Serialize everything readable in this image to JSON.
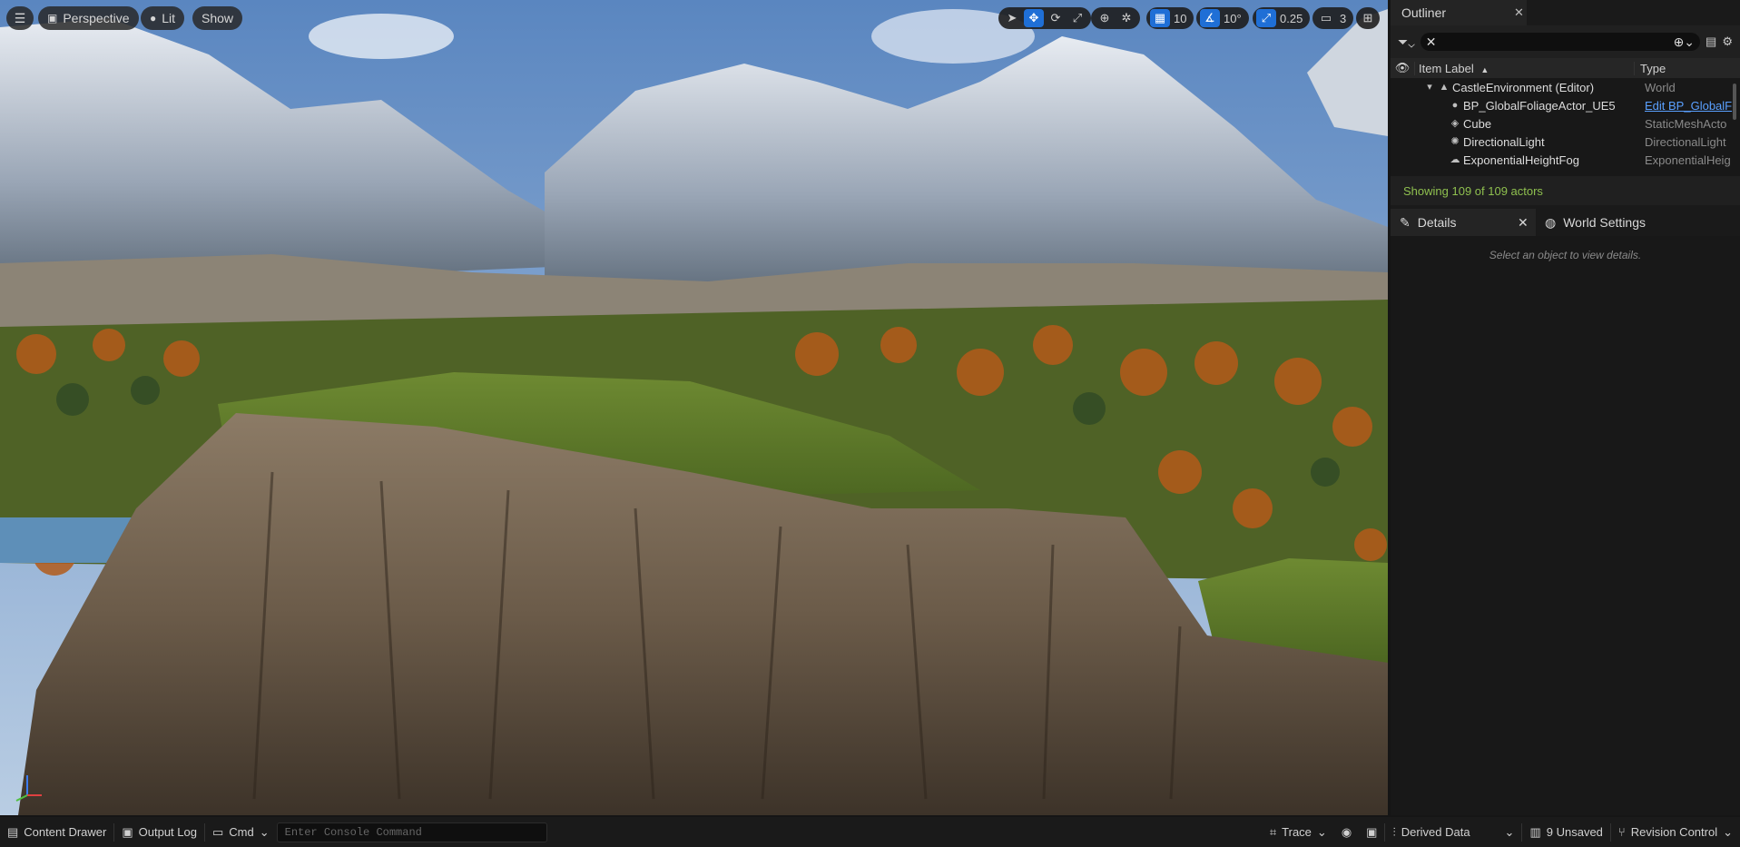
{
  "viewport": {
    "menu_icon": "hamburger-icon",
    "perspective_label": "Perspective",
    "lit_label": "Lit",
    "show_label": "Show",
    "toolbar": {
      "grid_value": "10",
      "rotation_value": "10°",
      "scale_value": "0.25",
      "camera_speed": "3",
      "accent": "#1f6fd6"
    }
  },
  "outliner": {
    "tab_title": "Outliner",
    "search_value": "",
    "col_label": "Item Label",
    "col_type": "Type",
    "rows": [
      {
        "label": "CastleEnvironment (Editor)",
        "type": "World",
        "icon": "world-icon"
      },
      {
        "label": "BP_GlobalFoliageActor_UE5",
        "type": "Edit BP_GlobalF",
        "icon": "blueprint-icon"
      },
      {
        "label": "Cube",
        "type": "StaticMeshActo",
        "icon": "cube-icon"
      },
      {
        "label": "DirectionalLight",
        "type": "DirectionalLight",
        "icon": "sun-icon"
      },
      {
        "label": "ExponentialHeightFog",
        "type": "ExponentialHeig",
        "icon": "fog-icon"
      }
    ],
    "status": "Showing 109 of 109 actors",
    "status_color": "#8fc04f"
  },
  "details": {
    "tab_title": "Details",
    "world_settings_title": "World Settings",
    "empty_message": "Select an object to view details."
  },
  "statusbar": {
    "content_drawer": "Content Drawer",
    "output_log": "Output Log",
    "cmd": "Cmd",
    "console_placeholder": "Enter Console Command",
    "trace": "Trace",
    "derived_data": "Derived Data",
    "unsaved": "9 Unsaved",
    "revision_control": "Revision Control"
  }
}
